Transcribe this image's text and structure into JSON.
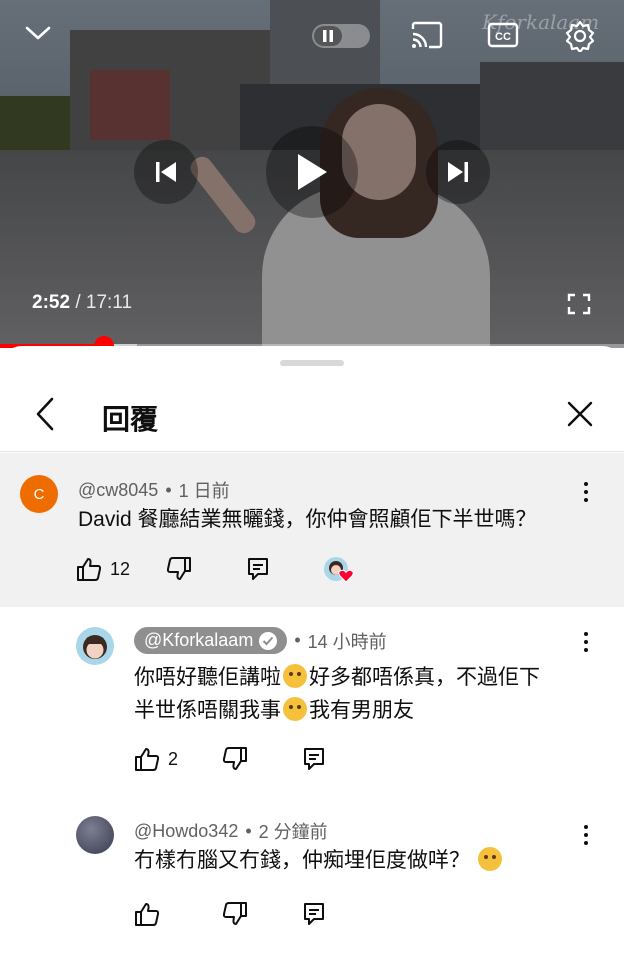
{
  "player": {
    "current_time": "2:52",
    "separator": "/",
    "duration": "17:11",
    "progress_fraction": 0.167,
    "buffer_fraction": 0.22,
    "watermark": "Kforkalaam",
    "accent_color": "#ff0000"
  },
  "sheet": {
    "title": "回覆"
  },
  "comments": [
    {
      "handle": "@cw8045",
      "age": "1 日前",
      "avatar_letter": "C",
      "avatar_color": "#ef6c00",
      "text": "David 餐廳結業無曬錢，你仲會照顧佢下半世嗎？",
      "likes": "12",
      "creator_hearted": true
    },
    {
      "handle": "@Kforkalaam",
      "verified": true,
      "age": "14 小時前",
      "text_line1_a": "你唔好聽佢講啦",
      "text_line1_b": "好多都唔係真，不過佢下",
      "text_line2_a": "半世係唔關我事",
      "text_line2_b": "我有男朋友",
      "emoji_1": "unamused-face",
      "emoji_2": "grinning-face-with-sweat",
      "likes": "2"
    },
    {
      "handle": "@Howdo342",
      "age": "2 分鐘前",
      "text": "冇樣冇腦又冇錢，仲痴埋佢度做咩？",
      "emoji": "face-with-tears-of-joy",
      "likes": ""
    }
  ],
  "meta_dot": "•",
  "icons": [
    "chevron-down-icon",
    "pause-icon",
    "cast-icon",
    "cc-icon",
    "gear-icon",
    "previous-icon",
    "play-icon",
    "next-icon",
    "fullscreen-icon",
    "back-arrow-icon",
    "close-icon",
    "more-vert-icon",
    "thumb-up-icon",
    "thumb-down-icon",
    "reply-icon",
    "heart-icon",
    "verified-icon"
  ]
}
